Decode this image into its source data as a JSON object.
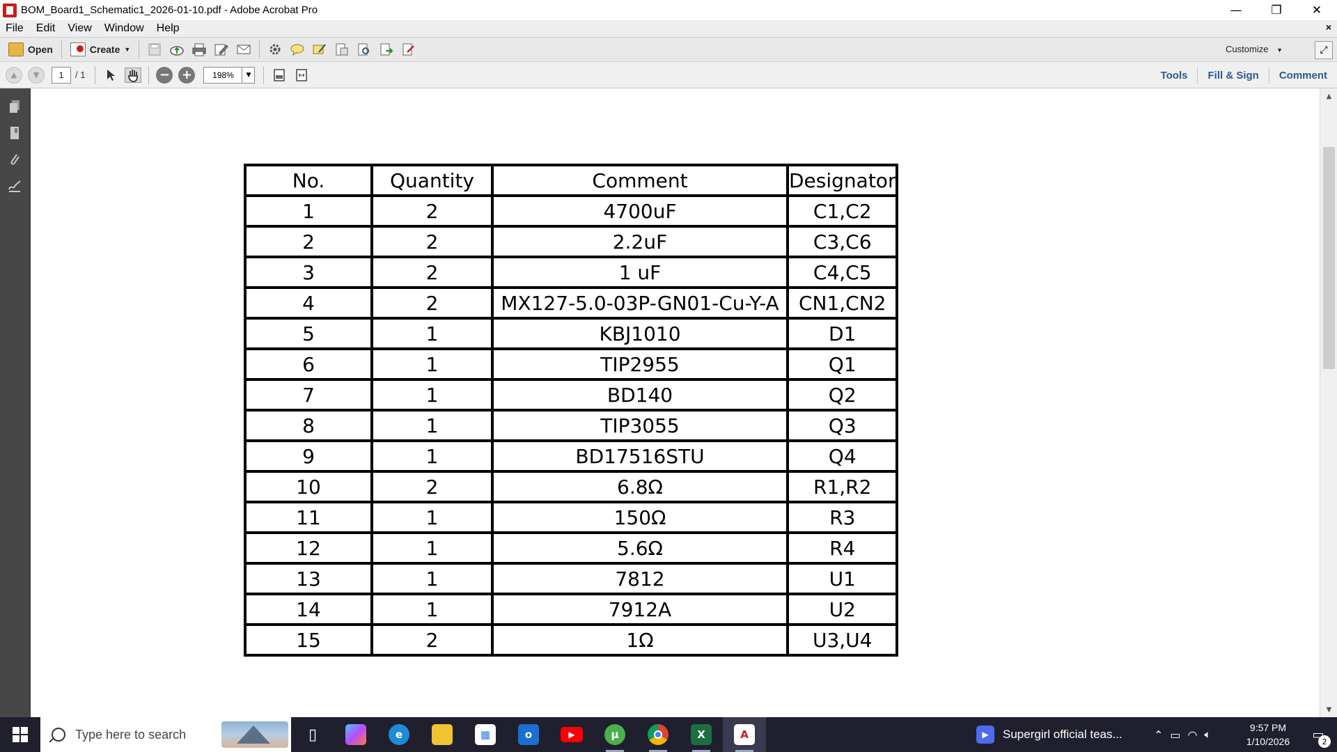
{
  "window": {
    "title": "BOM_Board1_Schematic1_2026-01-10.pdf - Adobe Acrobat Pro",
    "minimize_glyph": "—",
    "maximize_glyph": "❐",
    "close_glyph": "✕"
  },
  "menu": {
    "items": [
      "File",
      "Edit",
      "View",
      "Window",
      "Help"
    ],
    "close_doc_glyph": "×"
  },
  "toolbar1": {
    "open_label": "Open",
    "create_label": "Create",
    "customize_label": "Customize",
    "icons": [
      "save-icon",
      "cloud-upload-icon",
      "print-icon",
      "edit-icon",
      "email-icon",
      "gear-icon",
      "comment-bubble-icon",
      "highlight-icon",
      "document-extract-icon",
      "document-search-icon",
      "export-icon",
      "pdf-form-icon"
    ]
  },
  "toolbar2": {
    "page_current": "1",
    "page_total": "/ 1",
    "zoom_value": "198%",
    "right_tabs": [
      "Tools",
      "Fill & Sign",
      "Comment"
    ]
  },
  "bom_table": {
    "headers": [
      "No.",
      "Quantity",
      "Comment",
      "Designator"
    ],
    "rows": [
      [
        "1",
        "2",
        "4700uF",
        "C1,C2"
      ],
      [
        "2",
        "2",
        "2.2uF",
        "C3,C6"
      ],
      [
        "3",
        "2",
        "1 uF",
        "C4,C5"
      ],
      [
        "4",
        "2",
        "MX127-5.0-03P-GN01-Cu-Y-A",
        "CN1,CN2"
      ],
      [
        "5",
        "1",
        "KBJ1010",
        "D1"
      ],
      [
        "6",
        "1",
        "TIP2955",
        "Q1"
      ],
      [
        "7",
        "1",
        "BD140",
        "Q2"
      ],
      [
        "8",
        "1",
        "TIP3055",
        "Q3"
      ],
      [
        "9",
        "1",
        "BD17516STU",
        "Q4"
      ],
      [
        "10",
        "2",
        "6.8Ω",
        "R1,R2"
      ],
      [
        "11",
        "1",
        "150Ω",
        "R3"
      ],
      [
        "12",
        "1",
        "5.6Ω",
        "R4"
      ],
      [
        "13",
        "1",
        "7812",
        "U1"
      ],
      [
        "14",
        "1",
        "7912A",
        "U2"
      ],
      [
        "15",
        "2",
        "1Ω",
        "U3,U4"
      ]
    ]
  },
  "taskbar": {
    "search_placeholder": "Type here to search",
    "notification_text": "Supergirl official teas...",
    "clock_time": "9:57 PM",
    "clock_date": "1/10/2026",
    "notification_count": "2",
    "apps": [
      {
        "name": "task-view",
        "glyph": "▯",
        "color": "#1f1f2e"
      },
      {
        "name": "copilot",
        "glyph": "◆",
        "color": "#7b5cff"
      },
      {
        "name": "edge",
        "glyph": "e",
        "color": "#1f8ad8"
      },
      {
        "name": "file-explorer",
        "glyph": "▬",
        "color": "#f1c232"
      },
      {
        "name": "microsoft-store",
        "glyph": "▦",
        "color": "#2a7ae2"
      },
      {
        "name": "outlook",
        "glyph": "o",
        "color": "#1b6fd1"
      },
      {
        "name": "youtube",
        "glyph": "▶",
        "color": "#ff0000"
      },
      {
        "name": "utorrent",
        "glyph": "µ",
        "color": "#4bb04b"
      },
      {
        "name": "chrome",
        "glyph": "◉",
        "color": "#db4437"
      },
      {
        "name": "excel",
        "glyph": "X",
        "color": "#1d6f42"
      },
      {
        "name": "acrobat",
        "glyph": "A",
        "color": "#ffffff"
      }
    ]
  },
  "colors": {
    "accent_tab_text": "#2a5a8f",
    "left_nav_bg": "#474747",
    "taskbar_bg": "#1f1f2e"
  }
}
